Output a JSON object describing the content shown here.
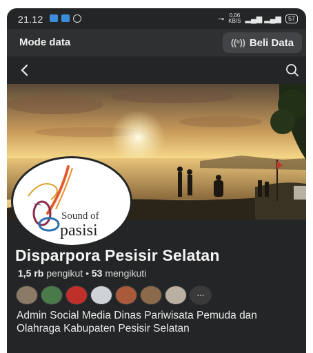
{
  "status_bar": {
    "time": "21.12",
    "speed_value": "0,06",
    "speed_unit": "KB/S",
    "battery": "57"
  },
  "mode_bar": {
    "title": "Mode data",
    "buy_button": "Beli Data"
  },
  "page": {
    "name": "Disparpora Pesisir Selatan",
    "followers_count": "1,5 rb",
    "followers_label": "pengikut",
    "separator": "•",
    "following_count": "53",
    "following_label": "mengikuti",
    "bio": "Admin Social Media Dinas Pariwisata Pemuda dan Olahraga Kabupaten Pesisir Selatan",
    "logo_text_top": "Sound of",
    "logo_text_bottom": "pasisi",
    "more_dots": "..."
  },
  "colors": {
    "background": "#242526",
    "mode_bar": "#2f3031",
    "button": "#434447",
    "text": "#f5f5f5"
  },
  "icons": [
    "back-arrow-icon",
    "search-icon",
    "data-signal-icon"
  ]
}
